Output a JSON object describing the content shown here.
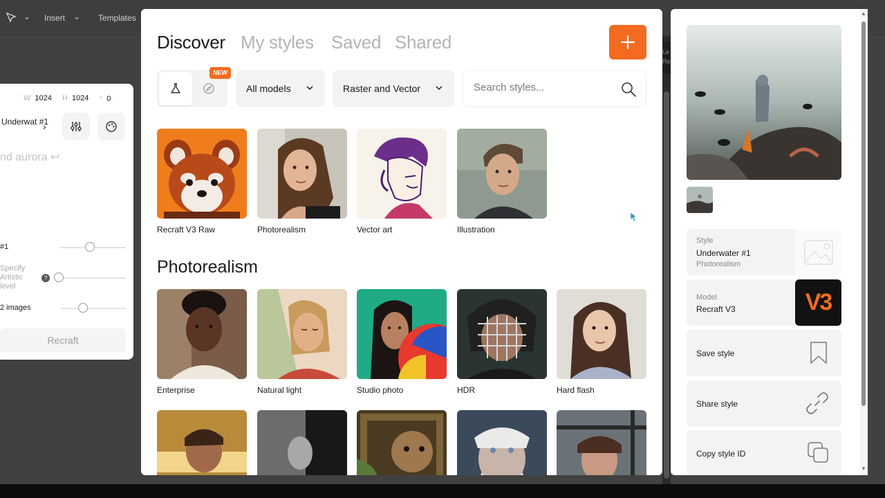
{
  "toolbar": {
    "insert": "Insert",
    "templates": "Templates"
  },
  "side_strip": {
    "label": "Le Re"
  },
  "left_panel": {
    "width_label": "W",
    "width_value": "1024",
    "height_label": "H",
    "height_value": "1024",
    "seed_value": "0",
    "style_name": "Underwat #1",
    "prompt_placeholder": "nd aurora ↩",
    "row1_label": "#1",
    "row2_label": "Specify Artistic level",
    "row3_label": "2 images",
    "recraft_button": "Recraft"
  },
  "modal": {
    "tabs": [
      {
        "label": "Discover"
      },
      {
        "label": "My styles"
      },
      {
        "label": "Saved"
      },
      {
        "label": "Shared"
      }
    ],
    "new_badge": "NEW",
    "models_dropdown": "All models",
    "type_dropdown": "Raster and Vector",
    "search_placeholder": "Search styles...",
    "featured": [
      {
        "label": "Recraft V3 Raw"
      },
      {
        "label": "Photorealism"
      },
      {
        "label": "Vector art"
      },
      {
        "label": "Illustration"
      }
    ],
    "section_title": "Photorealism",
    "photo_styles": [
      {
        "label": "Enterprise"
      },
      {
        "label": "Natural light"
      },
      {
        "label": "Studio photo"
      },
      {
        "label": "HDR"
      },
      {
        "label": "Hard flash"
      }
    ]
  },
  "right_panel": {
    "style_key": "Style",
    "style_name": "Underwater #1",
    "style_sub": "Photorealism",
    "model_key": "Model",
    "model_name": "Recraft V3",
    "model_badge": "V3",
    "actions": [
      {
        "label": "Save style"
      },
      {
        "label": "Share style"
      },
      {
        "label": "Copy style ID"
      }
    ]
  },
  "colors": {
    "accent": "#f26b21"
  }
}
